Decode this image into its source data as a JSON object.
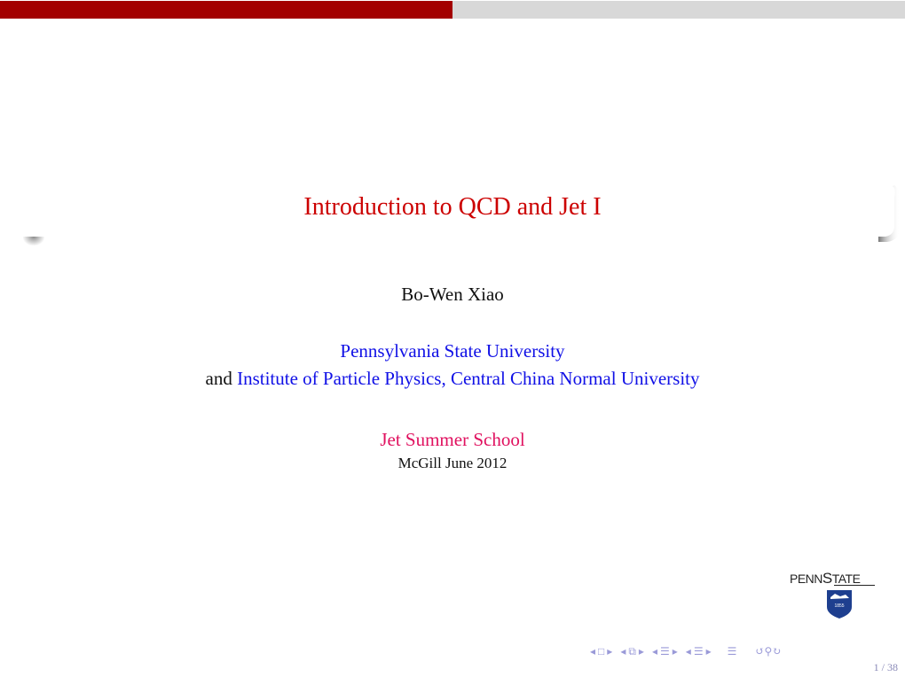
{
  "progress": {
    "fraction": 0.5,
    "fill_color": "#a30000",
    "track_color": "#d8d8d8"
  },
  "slide": {
    "title": "Introduction to QCD and Jet I",
    "author": "Bo-Wen Xiao",
    "institution_1": "Pennsylvania State University",
    "institution_2_prefix": "and",
    "institution_2": "Institute of Particle Physics, Central China Normal University",
    "event": "Jet Summer School",
    "date": "McGill June 2012"
  },
  "logo": {
    "text_small_1": "PENN",
    "text_big": "S",
    "text_small_2": "TATE",
    "year": "1855"
  },
  "navigation": {
    "icons": [
      "nav-left-arrow",
      "frame-icon",
      "nav-right-arrow",
      "nav-left-arrow",
      "subsection-icon",
      "nav-right-arrow",
      "nav-left-arrow",
      "section-icon",
      "nav-right-arrow",
      "nav-left-arrow",
      "document-icon",
      "nav-right-arrow",
      "align-icon",
      "undo-icon",
      "search-icon",
      "redo-icon"
    ],
    "page": "1 / 38"
  },
  "colors": {
    "title": "#cc0000",
    "link": "#1010e6",
    "event": "#e0115f"
  }
}
